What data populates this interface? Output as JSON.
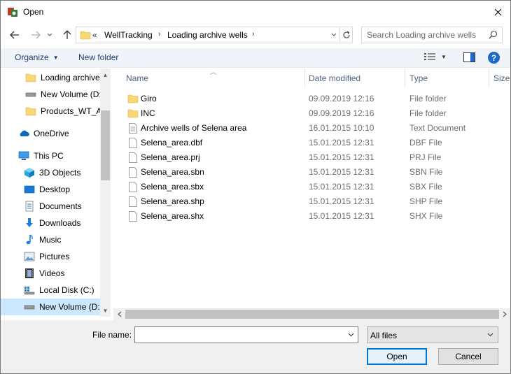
{
  "window": {
    "title": "Open",
    "colors": {
      "accent": "#0078d7",
      "selection": "#cce8ff",
      "folder": "#f8d775",
      "help": "#1b6ac9"
    }
  },
  "address": {
    "overflow": "«",
    "segments": [
      "WellTracking",
      "Loading archive wells"
    ]
  },
  "search": {
    "placeholder": "Search Loading archive wells"
  },
  "commandbar": {
    "organize": "Organize",
    "new_folder": "New folder",
    "help": "?"
  },
  "nav": {
    "items": [
      {
        "label": "Loading archive",
        "icon": "folder-icon"
      },
      {
        "label": "New Volume (D:",
        "icon": "drive-icon"
      },
      {
        "label": "Products_WT_AK",
        "icon": "folder-icon"
      },
      {
        "label": "OneDrive",
        "icon": "cloud-icon"
      },
      {
        "label": "This PC",
        "icon": "computer-icon"
      },
      {
        "label": "3D Objects",
        "icon": "cube-icon"
      },
      {
        "label": "Desktop",
        "icon": "desktop-icon"
      },
      {
        "label": "Documents",
        "icon": "document-icon"
      },
      {
        "label": "Downloads",
        "icon": "download-icon"
      },
      {
        "label": "Music",
        "icon": "music-icon"
      },
      {
        "label": "Pictures",
        "icon": "picture-icon"
      },
      {
        "label": "Videos",
        "icon": "video-icon"
      },
      {
        "label": "Local Disk (C:)",
        "icon": "windows-drive-icon"
      },
      {
        "label": "New Volume (D:",
        "icon": "drive-icon"
      }
    ]
  },
  "columns": {
    "name": "Name",
    "date": "Date modified",
    "type": "Type",
    "size": "Size"
  },
  "files": [
    {
      "name": "Giro",
      "date": "09.09.2019 12:16",
      "type": "File folder",
      "icon": "folder-icon"
    },
    {
      "name": "INC",
      "date": "09.09.2019 12:16",
      "type": "File folder",
      "icon": "folder-icon"
    },
    {
      "name": "Archive wells of Selena area",
      "date": "16.01.2015 10:10",
      "type": "Text Document",
      "icon": "text-file-icon"
    },
    {
      "name": "Selena_area.dbf",
      "date": "15.01.2015 12:31",
      "type": "DBF File",
      "icon": "file-icon"
    },
    {
      "name": "Selena_area.prj",
      "date": "15.01.2015 12:31",
      "type": "PRJ File",
      "icon": "file-icon"
    },
    {
      "name": "Selena_area.sbn",
      "date": "15.01.2015 12:31",
      "type": "SBN File",
      "icon": "file-icon"
    },
    {
      "name": "Selena_area.sbx",
      "date": "15.01.2015 12:31",
      "type": "SBX File",
      "icon": "file-icon"
    },
    {
      "name": "Selena_area.shp",
      "date": "15.01.2015 12:31",
      "type": "SHP File",
      "icon": "file-icon"
    },
    {
      "name": "Selena_area.shx",
      "date": "15.01.2015 12:31",
      "type": "SHX File",
      "icon": "file-icon"
    }
  ],
  "footer": {
    "filename_label": "File name:",
    "filename_value": "",
    "filter_value": "All files",
    "open_label": "Open",
    "cancel_label": "Cancel"
  }
}
